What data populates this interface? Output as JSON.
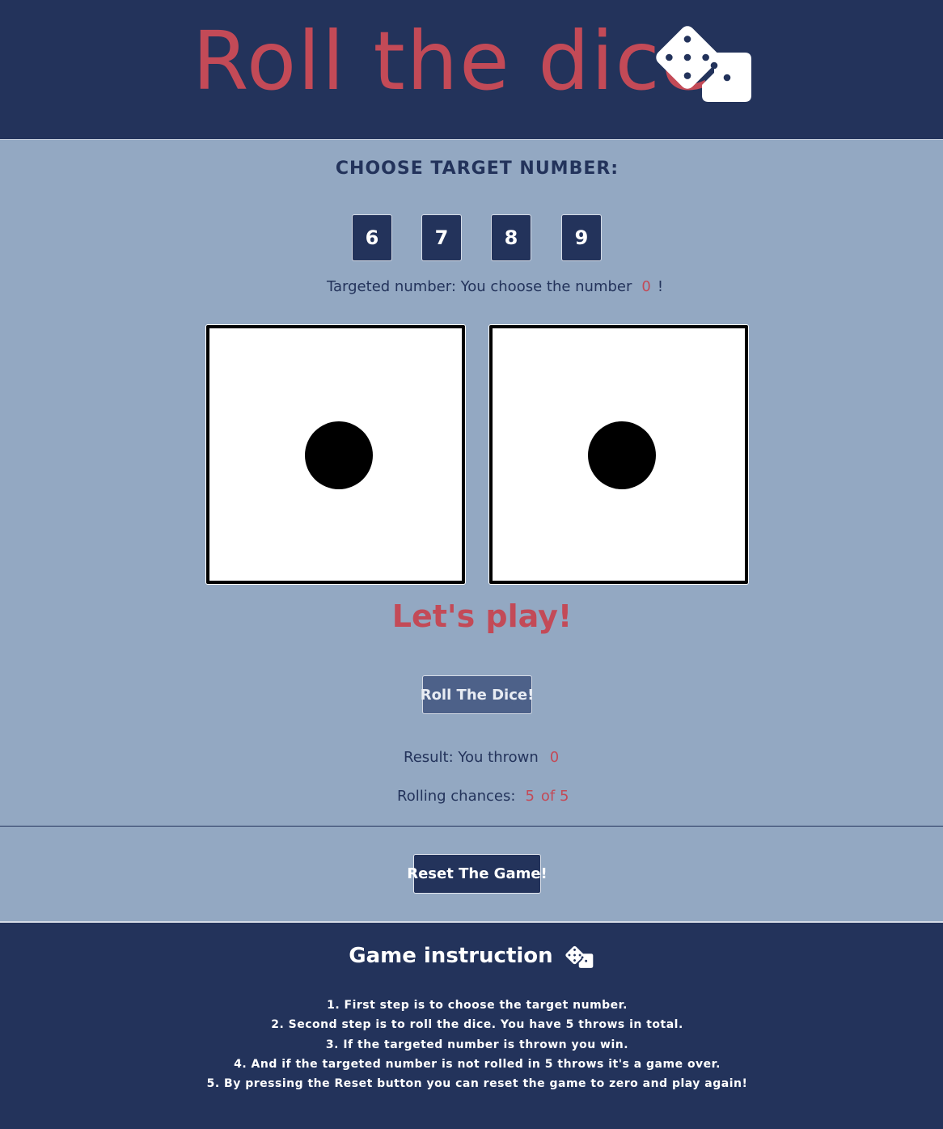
{
  "header": {
    "title": "Roll the dice"
  },
  "target": {
    "label": "CHOOSE TARGET NUMBER:",
    "options": [
      "6",
      "7",
      "8",
      "9"
    ],
    "targeted_text": "Targeted number: You choose the number",
    "targeted_value": "0",
    "targeted_suffix": "!"
  },
  "dice": [
    {
      "face": 1
    },
    {
      "face": 1
    }
  ],
  "game": {
    "status": "Let's play!",
    "roll_button": "Roll The Dice!",
    "result_text": "Result: You thrown",
    "result_value": "0",
    "chances_text": "Rolling chances:",
    "chances_value": "5",
    "chances_total": "of 5",
    "reset_button": "Reset The Game!"
  },
  "instructions": {
    "title": "Game instruction",
    "steps": [
      "1. First step is to choose the target number.",
      "2. Second step is to roll the dice. You have 5 throws in total.",
      "3. If the targeted number is thrown you win.",
      "4. And if the targeted number is not rolled in 5 throws it's a game over.",
      "5. By pressing the Reset button you can reset the game to zero and play again!"
    ]
  },
  "colors": {
    "navy": "#23335b",
    "accent_red": "#c34a57",
    "background": "#93a8c2",
    "roll_button_bg": "#4d6189"
  }
}
